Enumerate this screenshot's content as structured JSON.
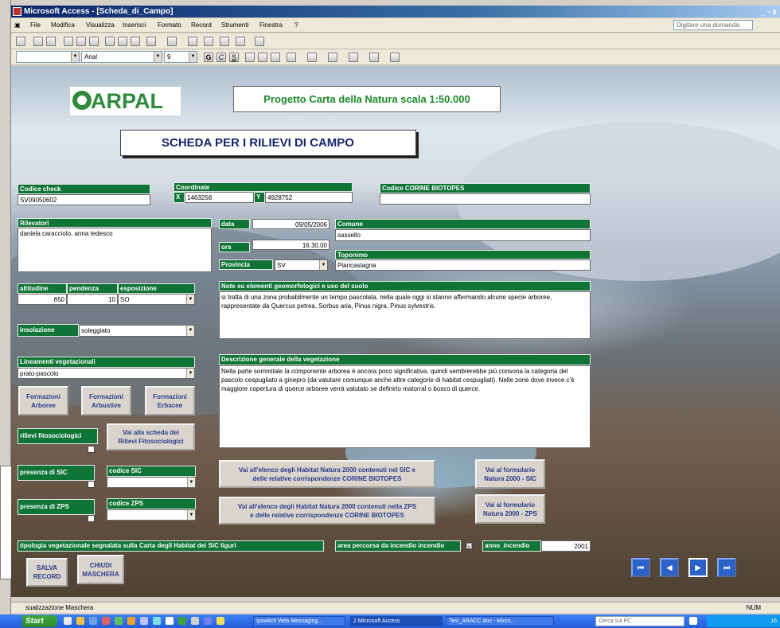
{
  "window": {
    "title": "Microsoft Access - [Scheda_di_Campo]",
    "controls": "_ ▫ x"
  },
  "menu": {
    "items": [
      "File",
      "Modifica",
      "Visualizza",
      "Inserisci",
      "Formato",
      "Record",
      "Strumenti",
      "Finestra",
      "?"
    ],
    "help_placeholder": "Digitare una domanda."
  },
  "format": {
    "object_combo": "",
    "font": "Arial",
    "size": "9"
  },
  "header": {
    "logo": "ARPAL",
    "project": "Progetto Carta della Natura scala 1:50.000",
    "title": "SCHEDA PER I RILIEVI DI CAMPO"
  },
  "fields": {
    "codice_check": {
      "label": "Codice check",
      "value": "SV09050602"
    },
    "coordinate": {
      "label": "Coordinate",
      "x_label": "X",
      "x": "1463258",
      "y_label": "Y",
      "y": "4928752"
    },
    "corine": {
      "label": "Codice CORINE BIOTOPES",
      "value": ""
    },
    "rilevatori": {
      "label": "Rilevatori",
      "value": "daniela caracciolo, anna tedesco"
    },
    "data": {
      "label": "data",
      "value": "09/05/2006"
    },
    "ora": {
      "label": "ora",
      "value": "16.30.00"
    },
    "provincia": {
      "label": "Provincia",
      "value": "SV"
    },
    "comune": {
      "label": "Comune",
      "value": "sassello"
    },
    "toponimo": {
      "label": "Toponimo",
      "value": "Piancastagna"
    },
    "altitudine": {
      "label": "altitudine",
      "value": "650"
    },
    "pendenza": {
      "label": "pendenza",
      "value": "10"
    },
    "esposizione": {
      "label": "esposizione",
      "value": "SO"
    },
    "note": {
      "label": "Note su elementi geomorfologici e uso del suolo",
      "value": "si tratta di una zona probabilmente un tempo pascolata, nella quale oggi si stanno affermando alcune specie arboree, rappresentate da Quercus petrea, Sorbus aria, Pinus nigra, Pinus sylvestris."
    },
    "insolazione": {
      "label": "insolazione",
      "value": "soleggiato"
    },
    "lineamenti": {
      "label": "Lineamenti vegetazionali",
      "value": "prato-pascolo"
    },
    "descrizione": {
      "label": "Descrizione generale della vegetazione",
      "value": "Nella parte sommitale la componente arborea è ancora poco significativa, quindi sembrerebbe più consona la categoria del pascolo cespugliato a ginepro (da valutare comunque anche altre categorie di habitat cespugliati). Nelle zone dove invece c'è maggiore copertura di querce arboree verrà valutato se definirlo matorral o bosco di querce."
    },
    "rilievi": {
      "label": "rilievi fitosociologici"
    },
    "presenza_sic": {
      "label": "presenza di SIC"
    },
    "codice_sic": {
      "label": "codice SIC",
      "value": ""
    },
    "presenza_zps": {
      "label": "presenza di ZPS"
    },
    "codice_zps": {
      "label": "codice ZPS",
      "value": ""
    },
    "tipologia": {
      "label": "tipologia vegetazionale segnalata sulla Carta degli Habitat dei SIC liguri"
    },
    "incendio": {
      "label": "area percorsa da incendio incendio",
      "checked": "☑"
    },
    "anno_incendio": {
      "label": "anno_incendio",
      "value": "2001"
    }
  },
  "buttons": {
    "arboree": "Formazioni\nArboree",
    "arbustive": "Formazioni\nArbustive",
    "erbacee": "Formazioni\nErbacee",
    "vai_rilievi": "Vai alla scheda dei\nRilievi Fitosociologici",
    "habitat_sic": "Vai all'elenco degli Habitat Natura 2000 contenuti nel SIC e\ndelle relative corrispondenze CORINE BIOTOPES",
    "form_sic": "Vai al formulario\nNatura 2000 - SIC",
    "habitat_zps": "Vai all'elenco degli Habitat Natura 2000 contenuti nella ZPS\ne delle relative corrispondenze CORINE BIOTOPES",
    "form_zps": "Vai al formulario\nNatura 2000 - ZPS",
    "salva": "SALVA\nRECORD",
    "chiudi": "CHIUDI\nMASCHERA",
    "nav": [
      "⏮",
      "◀",
      "▶",
      "⏭"
    ]
  },
  "status": {
    "text": "sualizzazione Maschera",
    "mode": "NUM"
  },
  "taskbar": {
    "start": "Start",
    "tasks": [
      "Ipswitch Web Messaging...",
      "2 Microsoft Access",
      "Tesi_ARACC.doc - Micro..."
    ],
    "search": "Cerca sul PC",
    "time": "16"
  }
}
